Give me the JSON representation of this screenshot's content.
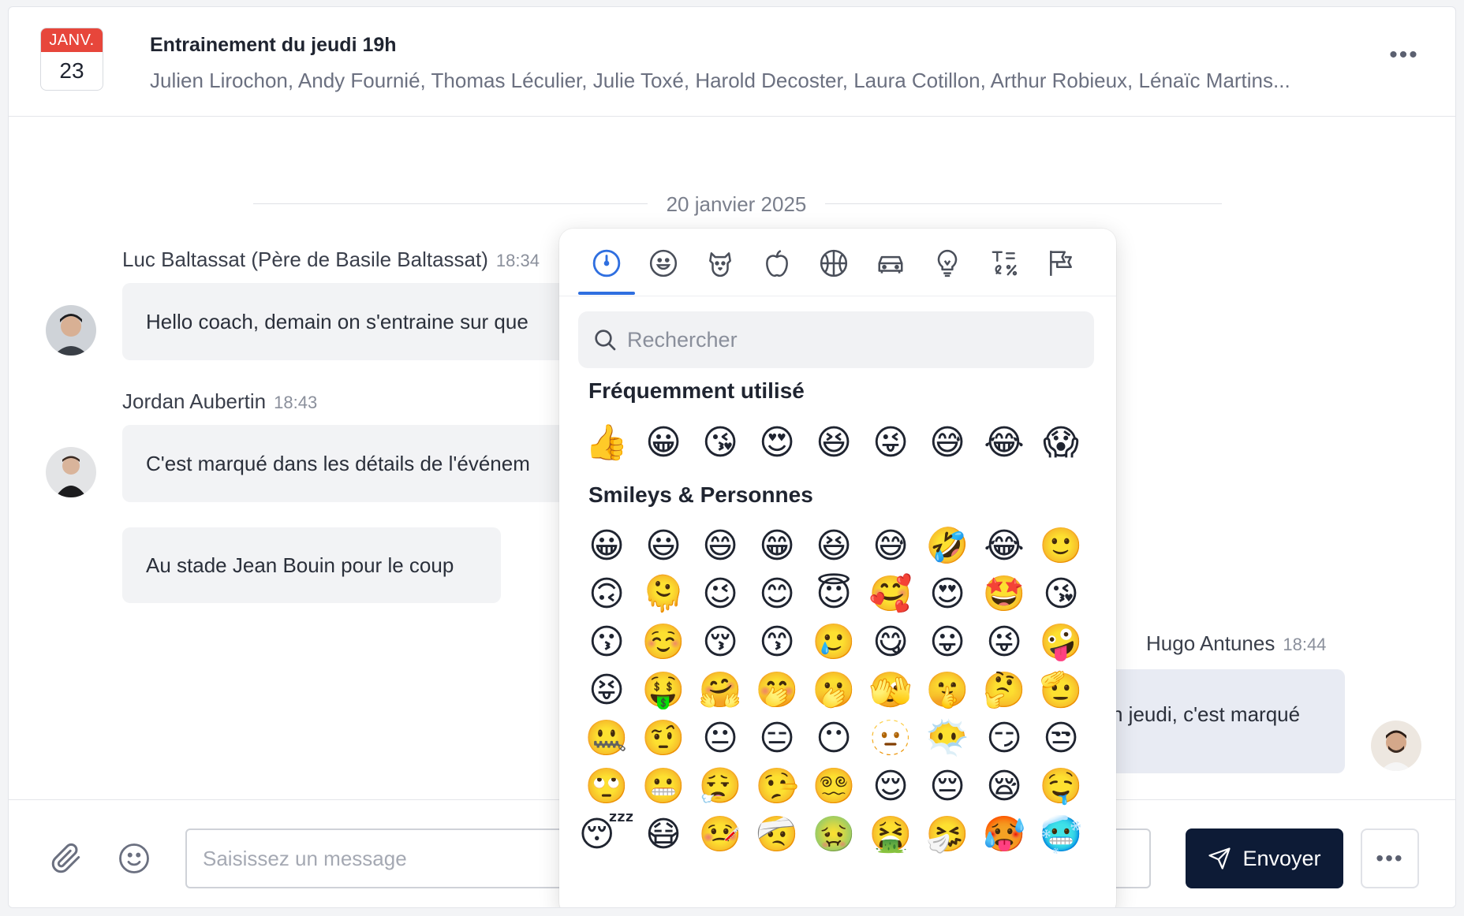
{
  "header": {
    "calendar_month": "JANV.",
    "calendar_day": "23",
    "title": "Entrainement du jeudi 19h",
    "participants": "Julien Lirochon, Andy Fournié, Thomas Léculier, Julie Toxé, Harold Decoster, Laura Cotillon, Arthur Robieux, Lénaïc Martins...",
    "more_icon": "more-horizontal-icon"
  },
  "date_divider": "20 janvier 2025",
  "messages": [
    {
      "sender": "Luc Baltassat (Père de Basile Baltassat)",
      "time": "18:34",
      "text": "Hello coach, demain on s'entraine sur que"
    },
    {
      "sender": "Jordan Aubertin",
      "time": "18:43",
      "text": "C'est marqué dans les détails de l'événem"
    },
    {
      "text": "Au stade Jean Bouin pour le coup"
    },
    {
      "sender": "Hugo Antunes",
      "time": "18:44",
      "text": "n jeudi, c'est marqué"
    }
  ],
  "composer": {
    "placeholder": "Saisissez un message",
    "value": "",
    "send_label": "Envoyer",
    "attach_icon": "paperclip-icon",
    "emoji_icon": "smiley-icon"
  },
  "emoji_picker": {
    "categories": [
      "recent-icon",
      "smileys-icon",
      "animals-icon",
      "food-icon",
      "activity-icon",
      "travel-icon",
      "objects-icon",
      "symbols-icon",
      "flags-icon"
    ],
    "active_category": "recent-icon",
    "search_placeholder": "Rechercher",
    "sections": [
      {
        "title": "Fréquemment utilisé",
        "rows": [
          [
            "👍",
            "😀",
            "😘",
            "😍",
            "😆",
            "😜",
            "😅",
            "😂",
            "😱"
          ]
        ]
      },
      {
        "title": "Smileys & Personnes",
        "rows": [
          [
            "😀",
            "😃",
            "😄",
            "😁",
            "😆",
            "😅",
            "🤣",
            "😂",
            "🙂"
          ],
          [
            "🙃",
            "🫠",
            "😉",
            "😊",
            "😇",
            "🥰",
            "😍",
            "🤩",
            "😘"
          ],
          [
            "😗",
            "☺️",
            "😚",
            "😙",
            "🥲",
            "😋",
            "😛",
            "😜",
            "🤪"
          ],
          [
            "😝",
            "🤑",
            "🤗",
            "🤭",
            "🫢",
            "🫣",
            "🤫",
            "🤔",
            "🫡"
          ],
          [
            "🤐",
            "🤨",
            "😐",
            "😑",
            "😶",
            "🫥",
            "😶‍🌫️",
            "😏",
            "😒"
          ],
          [
            "🙄",
            "😬",
            "😮‍💨",
            "🤥",
            "😵‍💫",
            "😌",
            "😔",
            "😪",
            "🤤"
          ],
          [
            "😴",
            "😷",
            "🤒",
            "🤕",
            "🤢",
            "🤮",
            "🤧",
            "🥵",
            "🥶"
          ]
        ]
      }
    ]
  }
}
